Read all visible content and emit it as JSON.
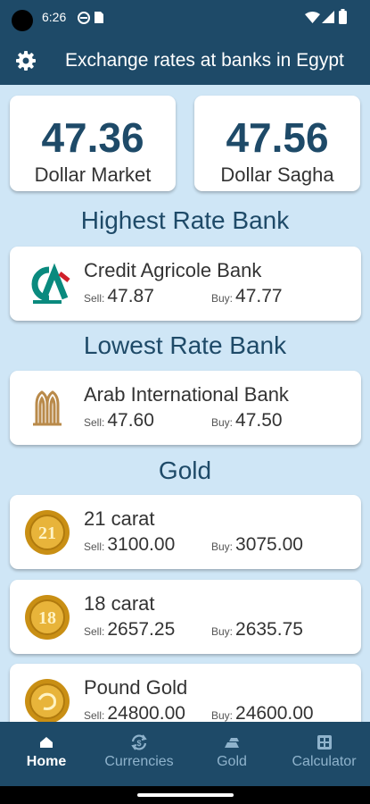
{
  "status": {
    "time": "6:26"
  },
  "app": {
    "title": "Exchange rates at banks in Egypt"
  },
  "rates": [
    {
      "value": "47.36",
      "label": "Dollar Market"
    },
    {
      "value": "47.56",
      "label": "Dollar Sagha"
    }
  ],
  "sections": {
    "highest": "Highest Rate Bank",
    "lowest": "Lowest Rate Bank",
    "gold": "Gold"
  },
  "labels": {
    "sell": "Sell:",
    "buy": "Buy:"
  },
  "highest_bank": {
    "name": "Credit Agricole Bank",
    "sell": "47.87",
    "buy": "47.77"
  },
  "lowest_bank": {
    "name": "Arab International Bank",
    "sell": "47.60",
    "buy": "47.50"
  },
  "gold_items": [
    {
      "name": "21 carat",
      "sell": "3100.00",
      "buy": "3075.00",
      "badge": "21"
    },
    {
      "name": "18 carat",
      "sell": "2657.25",
      "buy": "2635.75",
      "badge": "18"
    },
    {
      "name": "Pound Gold",
      "sell": "24800.00",
      "buy": "24600.00",
      "badge": ""
    }
  ],
  "nav": [
    {
      "label": "Home",
      "icon": "home-icon",
      "active": true
    },
    {
      "label": "Currencies",
      "icon": "currency-exchange-icon",
      "active": false
    },
    {
      "label": "Gold",
      "icon": "gold-bar-icon",
      "active": false
    },
    {
      "label": "Calculator",
      "icon": "calculator-icon",
      "active": false
    }
  ],
  "colors": {
    "primary": "#1e4a68",
    "background": "#cfe6f6",
    "gold": "#d8a21e"
  }
}
